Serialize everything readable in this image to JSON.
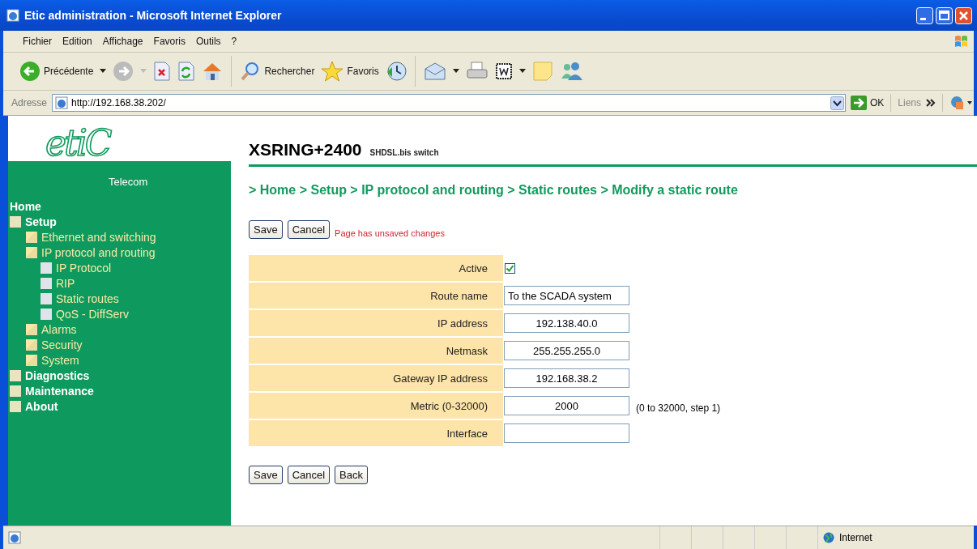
{
  "window": {
    "title": "Etic administration - Microsoft Internet Explorer"
  },
  "menu_bar": [
    "Fichier",
    "Edition",
    "Affichage",
    "Favoris",
    "Outils",
    "?"
  ],
  "toolbar": {
    "back": "Précédente",
    "search": "Rechercher",
    "favorites": "Favoris"
  },
  "address_bar": {
    "label": "Adresse",
    "url": "http://192.168.38.202/",
    "go": "OK",
    "links": "Liens"
  },
  "sidebar": {
    "logo": "etiC",
    "logo_sub": "Telecom",
    "items": [
      {
        "label": "Home",
        "kind": "plain"
      },
      {
        "label": "Setup",
        "kind": "folder",
        "children": [
          {
            "label": "Ethernet and switching",
            "kind": "folder"
          },
          {
            "label": "IP protocol and routing",
            "kind": "folder",
            "children": [
              {
                "label": "IP Protocol",
                "kind": "page"
              },
              {
                "label": "RIP",
                "kind": "page"
              },
              {
                "label": "Static routes",
                "kind": "page"
              },
              {
                "label": "QoS - DiffServ",
                "kind": "page"
              }
            ]
          },
          {
            "label": "Alarms",
            "kind": "folder"
          },
          {
            "label": "Security",
            "kind": "folder"
          },
          {
            "label": "System",
            "kind": "folder"
          }
        ]
      },
      {
        "label": "Diagnostics",
        "kind": "folder"
      },
      {
        "label": "Maintenance",
        "kind": "folder"
      },
      {
        "label": "About",
        "kind": "folder"
      }
    ]
  },
  "header": {
    "title": "XSRING+2400",
    "subtitle": "SHDSL.bis switch"
  },
  "breadcrumb": "> Home > Setup > IP protocol and routing > Static routes > Modify a static route",
  "top_actions": {
    "buttons": [
      "Save",
      "Cancel"
    ],
    "warning": "Page has unsaved changes"
  },
  "form": [
    {
      "label": "Active",
      "kind": "checkbox",
      "checked": true
    },
    {
      "label": "Route name",
      "kind": "text",
      "value": "To the SCADA system"
    },
    {
      "label": "IP address",
      "kind": "text",
      "value": "192.138.40.0"
    },
    {
      "label": "Netmask",
      "kind": "text",
      "value": "255.255.255.0"
    },
    {
      "label": "Gateway IP address",
      "kind": "text",
      "value": "192.168.38.2"
    },
    {
      "label": "Metric (0-32000)",
      "kind": "text",
      "value": "2000",
      "hint": "(0 to 32000, step 1)"
    },
    {
      "label": "Interface",
      "kind": "text"
    }
  ],
  "bottom_actions": [
    "Save",
    "Cancel",
    "Back"
  ],
  "status_bar": {
    "zone": "Internet"
  }
}
